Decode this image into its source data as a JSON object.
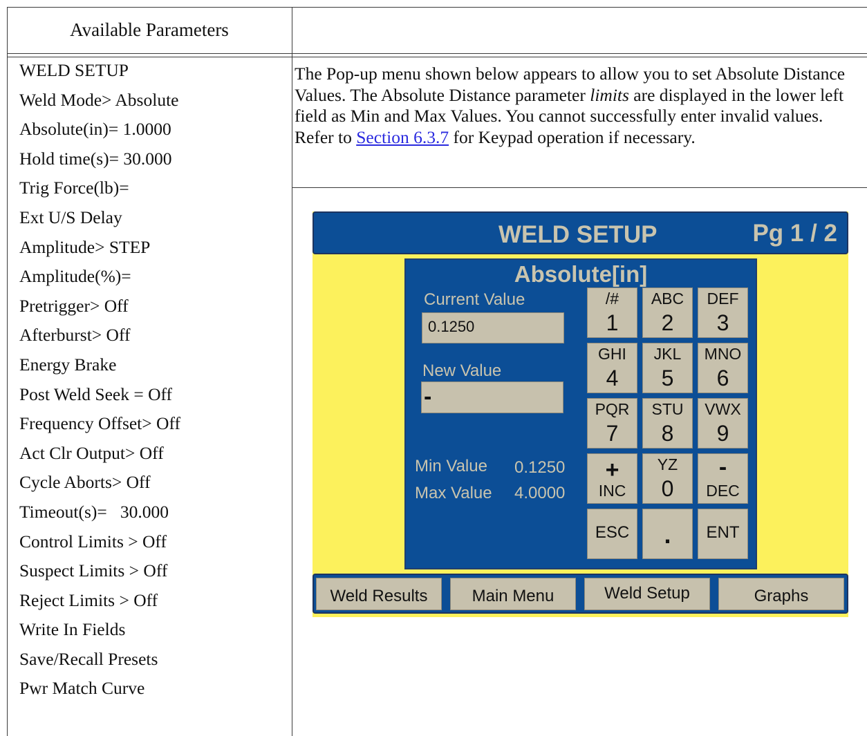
{
  "header": {
    "title": "Available Parameters"
  },
  "parameters": [
    "WELD SETUP",
    "Weld Mode> Absolute",
    "Absolute(in)= 1.0000",
    "Hold time(s)= 30.000",
    "Trig Force(lb)=",
    "Ext U/S Delay",
    "Amplitude> STEP",
    "Amplitude(%)=",
    "Pretrigger> Off",
    "Afterburst> Off",
    "Energy Brake",
    "Post Weld Seek = Off",
    "Frequency Offset> Off",
    "Act Clr Output> Off",
    "Cycle Aborts> Off",
    "Timeout(s)=   30.000",
    "Control Limits > Off",
    "Suspect Limits > Off",
    "Reject Limits > Off",
    "Write In Fields",
    "Save/Recall Presets",
    "Pwr Match Curve"
  ],
  "description": {
    "part1": "The Pop-up menu shown below appears to allow you to set Absolute Distance Values. The Absolute Distance parameter ",
    "emphasis": "limits",
    "part2": " are displayed in the lower left field as Min and Max Values. You cannot successfully enter invalid values. Refer to ",
    "link": "Section 6.3.7",
    "part3": " for Keypad operation if necessary."
  },
  "hmi": {
    "title": "WELD SETUP",
    "page": "Pg 1 / 2",
    "popup_title": "Absolute[in]",
    "current_value_label": "Current Value",
    "current_value": "0.1250",
    "new_value_label": "New Value",
    "new_value": "-",
    "min_label": "Min Value",
    "min_value": "0.1250",
    "max_label": "Max Value",
    "max_value": "4.0000",
    "keys": {
      "k1": {
        "letters": "/#",
        "digit": "1"
      },
      "k2": {
        "letters": "ABC",
        "digit": "2"
      },
      "k3": {
        "letters": "DEF",
        "digit": "3"
      },
      "k4": {
        "letters": "GHI",
        "digit": "4"
      },
      "k5": {
        "letters": "JKL",
        "digit": "5"
      },
      "k6": {
        "letters": "MNO",
        "digit": "6"
      },
      "k7": {
        "letters": "PQR",
        "digit": "7"
      },
      "k8": {
        "letters": "STU",
        "digit": "8"
      },
      "k9": {
        "letters": "VWX",
        "digit": "9"
      },
      "inc": {
        "symbol": "+",
        "label": "INC"
      },
      "k0": {
        "letters": "YZ",
        "digit": "0"
      },
      "dec": {
        "symbol": "-",
        "label": "DEC"
      },
      "esc": "ESC",
      "dot": ".",
      "ent": "ENT"
    },
    "nav": [
      "Weld Results",
      "Main Menu",
      "Weld Setup",
      "Graphs"
    ]
  }
}
